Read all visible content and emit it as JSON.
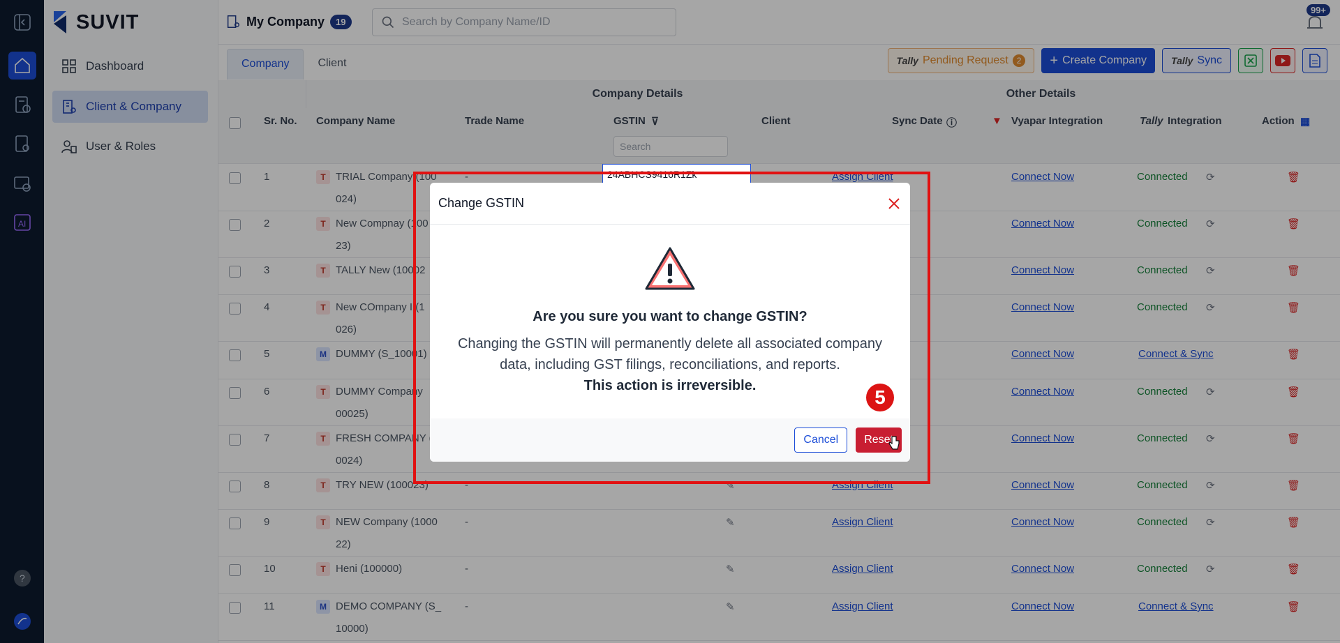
{
  "brand": {
    "name": "SUVIT"
  },
  "sidebar": {
    "items": [
      {
        "label": "Dashboard",
        "icon": "grid-icon"
      },
      {
        "label": "Client & Company",
        "icon": "building-icon"
      },
      {
        "label": "User & Roles",
        "icon": "user-roles-icon"
      }
    ]
  },
  "header": {
    "title": "My Company",
    "count": "19",
    "search_placeholder": "Search by Company Name/ID",
    "notif_count": "99+"
  },
  "tabs": [
    "Company",
    "Client"
  ],
  "actions": {
    "pending_tally": "Tally",
    "pending_label": "Pending Request",
    "pending_count": "2",
    "create_label": "Create Company",
    "sync_tally": "Tally",
    "sync_label": "Sync"
  },
  "table": {
    "groups": {
      "company": "Company Details",
      "other": "Other Details"
    },
    "headers": {
      "sr": "Sr. No.",
      "company": "Company Name",
      "trade": "Trade Name",
      "gstin": "GSTIN",
      "client": "Client",
      "sync": "Sync Date",
      "vyapar": "Vyapar Integration",
      "tally_prefix": "Tally",
      "integration": "Integration",
      "action": "Action"
    },
    "gstin_search_placeholder": "Search",
    "editing_gstin": "24ABHCS9416R1Zk",
    "rows": [
      {
        "sr": "1",
        "tag": "T",
        "name1": "TRIAL Company (100",
        "name2": "024)",
        "trade": "-",
        "client": "Assign Client",
        "vyapar": "Connect Now",
        "tally": "Connected"
      },
      {
        "sr": "2",
        "tag": "T",
        "name1": "New Compnay (100",
        "name2": "23)",
        "trade": "",
        "client": "",
        "vyapar": "Connect Now",
        "tally": "Connected"
      },
      {
        "sr": "3",
        "tag": "T",
        "name1": "TALLY New (10002",
        "name2": "",
        "trade": "",
        "client": "",
        "vyapar": "Connect Now",
        "tally": "Connected"
      },
      {
        "sr": "4",
        "tag": "T",
        "name1": "New COmpany I (1",
        "name2": "026)",
        "trade": "",
        "client": "",
        "vyapar": "Connect Now",
        "tally": "Connected"
      },
      {
        "sr": "5",
        "tag": "M",
        "name1": "DUMMY (S_10001)",
        "name2": "",
        "trade": "",
        "client": "",
        "vyapar": "Connect Now",
        "tally": "Connect & Sync"
      },
      {
        "sr": "6",
        "tag": "T",
        "name1": "DUMMY Company",
        "name2": "00025)",
        "trade": "",
        "client": "",
        "vyapar": "Connect Now",
        "tally": "Connected"
      },
      {
        "sr": "7",
        "tag": "T",
        "name1": "FRESH COMPANY (",
        "name2": "0024)",
        "trade": "",
        "client": "",
        "vyapar": "Connect Now",
        "tally": "Connected"
      },
      {
        "sr": "8",
        "tag": "T",
        "name1": "TRY NEW (100023)",
        "name2": "",
        "trade": "-",
        "client": "Assign Client",
        "vyapar": "Connect Now",
        "tally": "Connected"
      },
      {
        "sr": "9",
        "tag": "T",
        "name1": "NEW Company (1000",
        "name2": "22)",
        "trade": "-",
        "client": "Assign Client",
        "vyapar": "Connect Now",
        "tally": "Connected"
      },
      {
        "sr": "10",
        "tag": "T",
        "name1": "Heni (100000)",
        "name2": "",
        "trade": "-",
        "client": "Assign Client",
        "vyapar": "Connect Now",
        "tally": "Connected"
      },
      {
        "sr": "11",
        "tag": "M",
        "name1": "DEMO COMPANY (S_",
        "name2": "10000)",
        "trade": "-",
        "client": "Assign Client",
        "vyapar": "Connect Now",
        "tally": "Connect & Sync"
      }
    ]
  },
  "dialog": {
    "title": "Change GSTIN",
    "question": "Are you sure you want to change GSTIN?",
    "message": "Changing the GSTIN will permanently delete all associated company data, including GST filings, reconciliations, and reports.",
    "warning": "This action is irreversible.",
    "cancel": "Cancel",
    "reset": "Reset"
  },
  "step_marker": "5"
}
